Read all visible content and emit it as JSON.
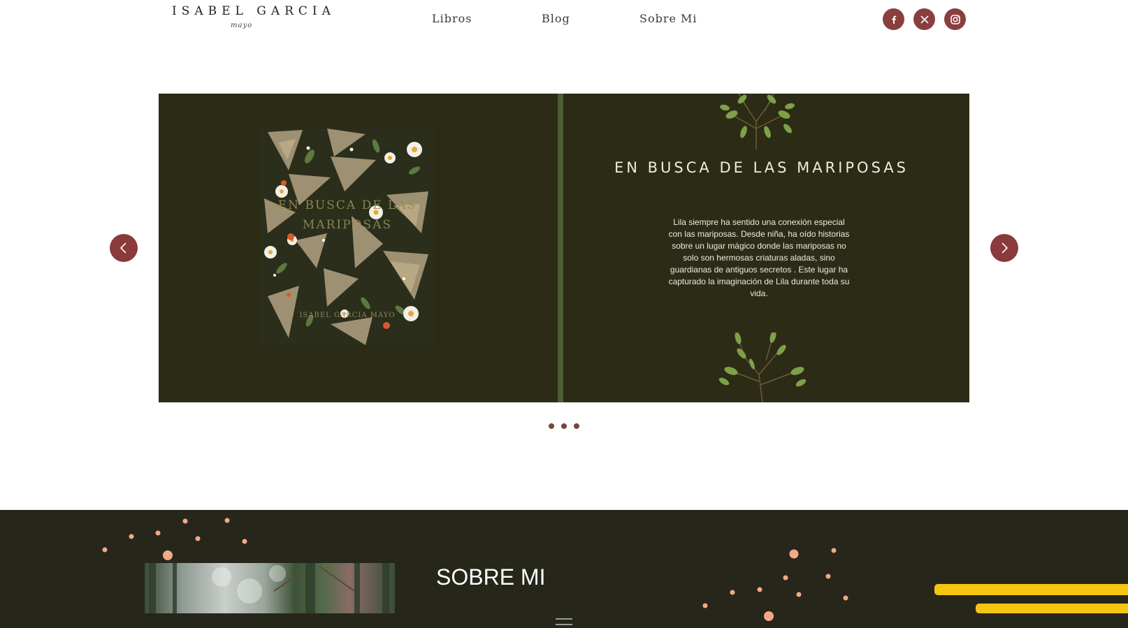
{
  "header": {
    "logo_name": "ISABEL GARCIA",
    "logo_script": "mayo",
    "nav": [
      {
        "label": "Libros"
      },
      {
        "label": "Blog"
      },
      {
        "label": "Sobre Mi"
      }
    ],
    "social": [
      {
        "icon": "facebook-icon"
      },
      {
        "icon": "x-icon"
      },
      {
        "icon": "instagram-icon"
      }
    ]
  },
  "slider": {
    "book_cover": {
      "title": "EN BUSCA DE LAS MARIPOSAS",
      "author": "ISABEL GARCIA MAYO"
    },
    "title": "EN BUSCA DE LAS MARIPOSAS",
    "description": "Lila siempre ha sentido una conexión especial con las mariposas. Desde niña, ha oído historias sobre un lugar mágico donde las mariposas no solo son hermosas criaturas aladas, sino guardianas de antiguos secretos . Este lugar ha capturado la imaginación de Lila durante toda su vida.",
    "prev_icon": "chevron-left-icon",
    "next_icon": "chevron-right-icon",
    "dots_count": 3
  },
  "about": {
    "title": "SOBRE MI"
  },
  "colors": {
    "accent": "#8a3f3f",
    "slide_bg": "#2c2b16",
    "divider": "#4c5e33",
    "about_bg": "#27261b",
    "stripe": "#f5c510",
    "dot": "#7b4638"
  }
}
